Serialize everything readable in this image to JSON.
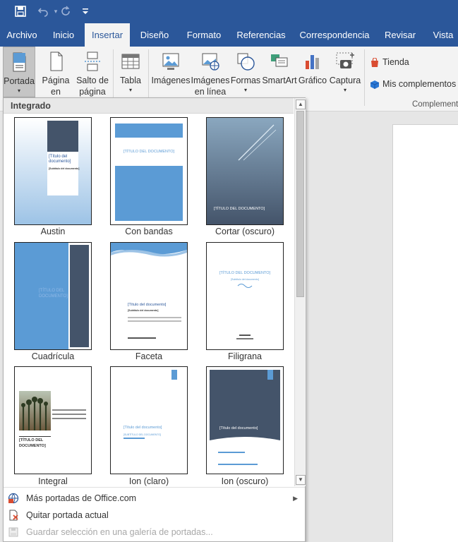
{
  "qat": {
    "save_icon": "save-icon",
    "undo_icon": "undo-icon",
    "redo_icon": "redo-icon",
    "customize_icon": "customize-qat-icon"
  },
  "tabs": [
    {
      "label": "Archivo"
    },
    {
      "label": "Inicio"
    },
    {
      "label": "Insertar"
    },
    {
      "label": "Diseño"
    },
    {
      "label": "Formato"
    },
    {
      "label": "Referencias"
    },
    {
      "label": "Correspondencia"
    },
    {
      "label": "Revisar"
    },
    {
      "label": "Vista"
    }
  ],
  "ribbon": {
    "portada": {
      "label": "Portada"
    },
    "pagina_blanco": {
      "label1": "Página",
      "label2": "en blanco"
    },
    "salto_pagina": {
      "label1": "Salto de",
      "label2": "página"
    },
    "tabla": {
      "label": "Tabla"
    },
    "imagenes": {
      "label": "Imágenes"
    },
    "imagenes_linea": {
      "label1": "Imágenes",
      "label2": "en línea"
    },
    "formas": {
      "label": "Formas"
    },
    "smartart": {
      "label": "SmartArt"
    },
    "grafico": {
      "label": "Gráfico"
    },
    "captura": {
      "label": "Captura"
    },
    "tienda": {
      "label": "Tienda"
    },
    "mis_complementos": {
      "label": "Mis complementos"
    },
    "group_complementos": "Complement"
  },
  "dropdown": {
    "header": "Integrado",
    "thumbs": [
      {
        "label": "Austin",
        "title": "[Título del documento]",
        "subtitle": "[Subtítulo del documento]"
      },
      {
        "label": "Con bandas",
        "title": "[TÍTULO DEL DOCUMENTO]"
      },
      {
        "label": "Cortar (oscuro)",
        "title": "[TÍTULO DEL DOCUMENTO]"
      },
      {
        "label": "Cuadrícula",
        "title": "[TÍTULO DEL DOCUMENTO]"
      },
      {
        "label": "Faceta",
        "title": "[Título del documento]",
        "subtitle": "[Subtítulo del documento]"
      },
      {
        "label": "Filigrana",
        "title": "[TÍTULO DEL DOCUMENTO]",
        "subtitle": "[Subtítulo del documento]"
      },
      {
        "label": "Integral",
        "title": "[TÍTULO DEL DOCUMENTO]"
      },
      {
        "label": "Ion (claro)",
        "title": "[Título del documento]",
        "subtitle": "[SUBTÍTULO DEL DOCUMENTO]"
      },
      {
        "label": "Ion (oscuro)",
        "title": "[Título del documento]"
      }
    ],
    "menu": [
      {
        "label": "Más portadas de Office.com",
        "icon": "office-globe-icon"
      },
      {
        "label": "Quitar portada actual",
        "icon": "remove-cover-icon"
      },
      {
        "label": "Guardar selección en una galería de portadas...",
        "icon": "save-gallery-icon"
      }
    ]
  },
  "colors": {
    "brand": "#2b579a",
    "thumb_blue": "#5b9bd5",
    "thumb_dark": "#44546a"
  }
}
